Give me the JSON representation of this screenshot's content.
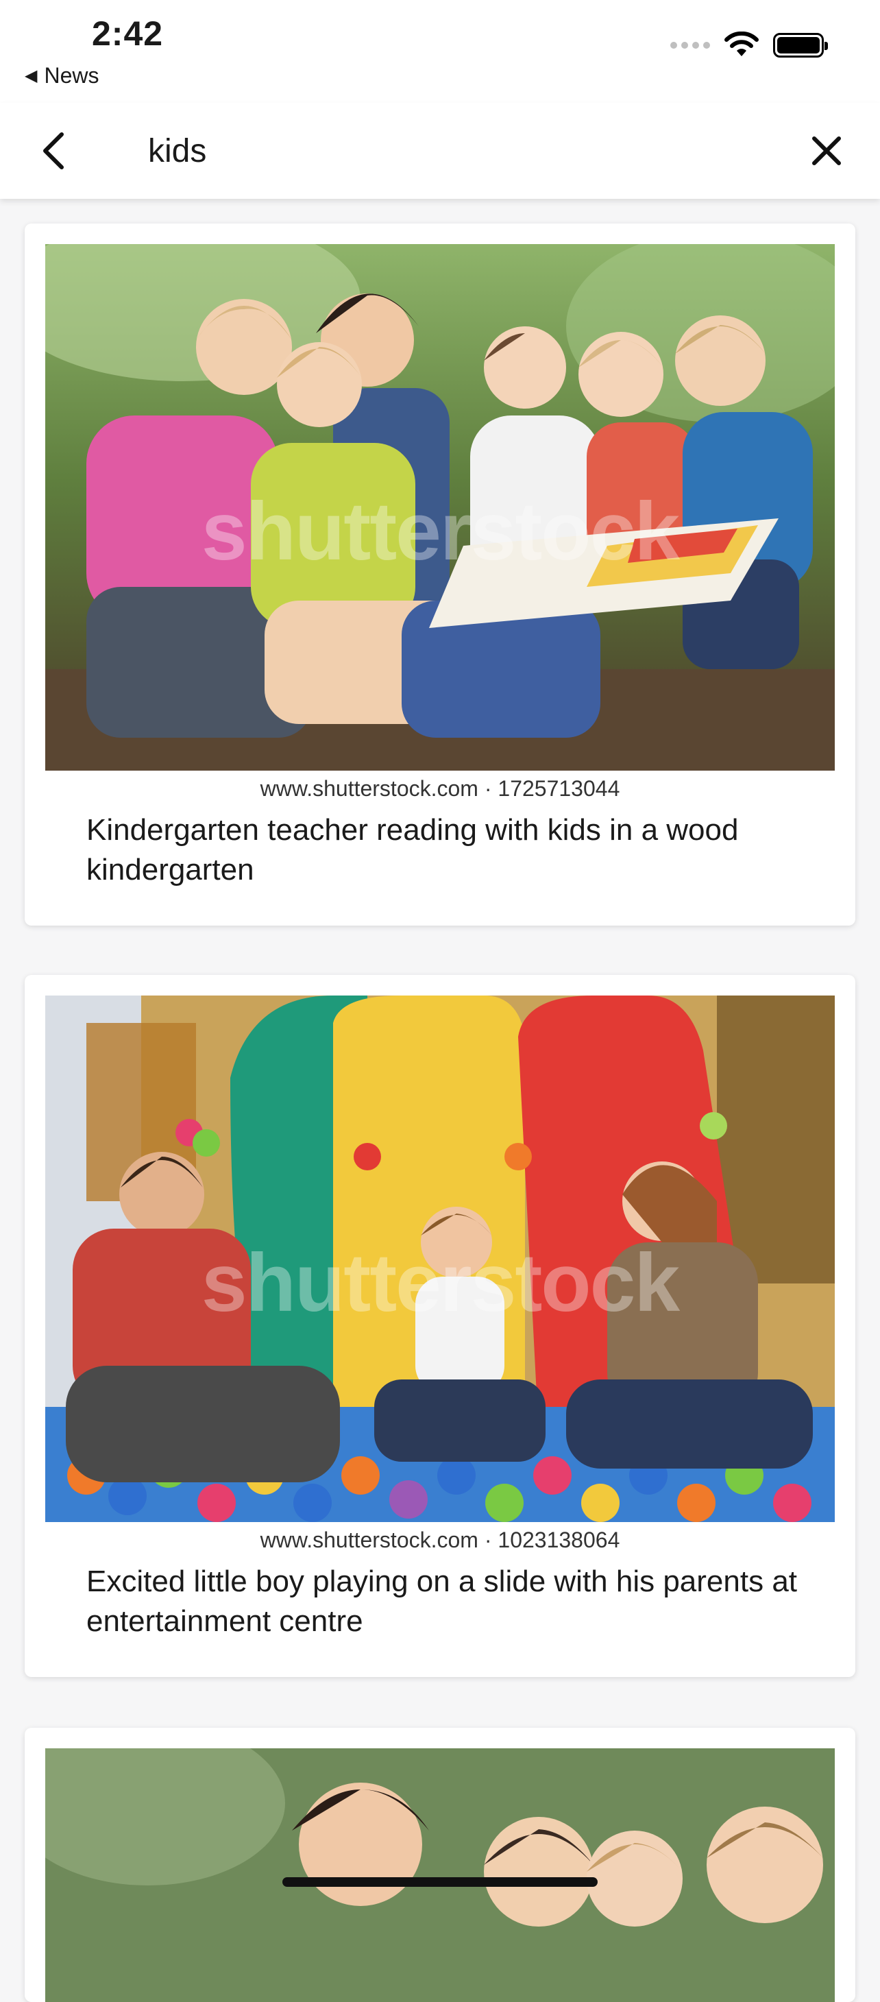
{
  "status_bar": {
    "time": "2:42",
    "back_app_label": "News"
  },
  "search": {
    "value": "kids"
  },
  "results": [
    {
      "stock_id": "www.shutterstock.com · 1725713044",
      "caption": "Kindergarten teacher reading with kids in a wood kindergarten",
      "watermark": "shutterstock"
    },
    {
      "stock_id": "www.shutterstock.com · 1023138064",
      "caption": "Excited little boy playing on a slide with his parents at entertainment centre",
      "watermark": "shutterstock"
    },
    {
      "stock_id": "",
      "caption": "",
      "watermark": ""
    }
  ]
}
